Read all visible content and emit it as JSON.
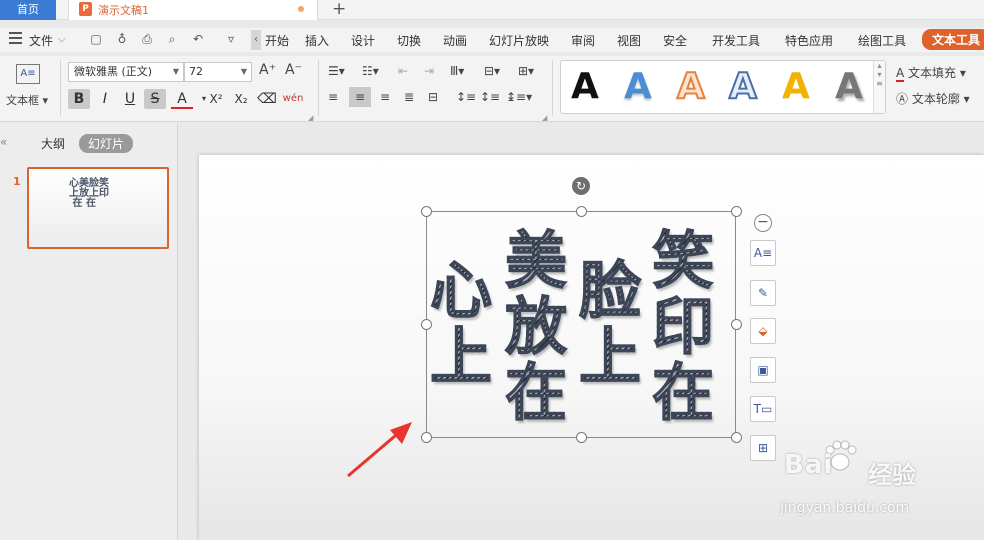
{
  "titlebar": {
    "home_tab": "首页",
    "doc_tab_title": "演示文稿1",
    "doc_icon_letter": "P",
    "new_tab": "+"
  },
  "menubar": {
    "file": "文件",
    "items": [
      "开始",
      "插入",
      "设计",
      "切换",
      "动画",
      "幻灯片放映",
      "审阅",
      "视图",
      "安全",
      "开发工具",
      "特色应用",
      "绘图工具",
      "文本工具"
    ],
    "active": "文本工具"
  },
  "ribbon": {
    "textbox_label": "文本框",
    "font_name": "微软雅黑 (正文)",
    "font_size": "72",
    "text_fill": "文本填充",
    "text_outline": "文本轮廓",
    "pinyin_glyph": "wén",
    "styles": [
      {
        "letter": "A",
        "color": "#111111"
      },
      {
        "letter": "A",
        "color": "#4a8fd6"
      },
      {
        "letter": "A",
        "color": "#e87f3c"
      },
      {
        "letter": "A",
        "color": "#e8eef8"
      },
      {
        "letter": "A",
        "color": "#f0b400"
      },
      {
        "letter": "A",
        "color": "#777777"
      }
    ]
  },
  "leftpane": {
    "tab_outline": "大纲",
    "tab_slides": "幻灯片",
    "slide_number": "1",
    "thumb_text": "心美脸笑\n上放上印\n 在 在"
  },
  "slide": {
    "columns": [
      "心\n上",
      "美\n放\n在",
      "脸\n上",
      "笑\n印\n在"
    ]
  },
  "watermark": {
    "logo": "Bai",
    "logo_tail": "du",
    "jingyan": "经验",
    "url": "jingyan.baidu.com"
  },
  "colors": {
    "accent": "#e0622b",
    "home_tab": "#3a7bd5"
  }
}
